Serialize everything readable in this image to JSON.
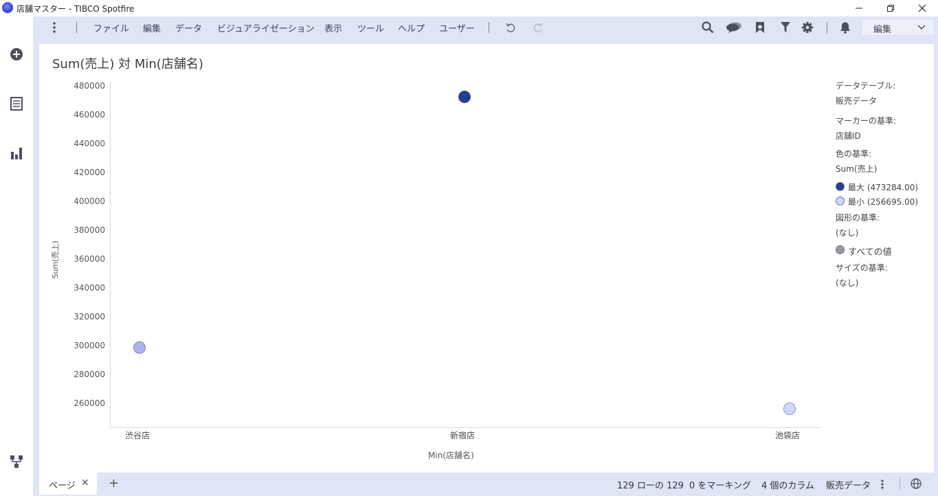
{
  "window": {
    "title": "店舗マスター - TIBCO Spotfire",
    "minimize_glyph": "—",
    "close_glyph": "✕"
  },
  "menu": {
    "items": [
      "ファイル",
      "編集",
      "データ",
      "ビジュアライゼーション",
      "表示",
      "ツール",
      "ヘルプ",
      "ユーザー"
    ],
    "mode_select": "編集"
  },
  "left_rail": {
    "icons": [
      "add-icon",
      "data-table-icon",
      "visualization-icon",
      "data-canvas-icon"
    ]
  },
  "toolbar_icons": [
    "undo-icon",
    "redo-icon",
    "search-icon",
    "collaboration-icon",
    "bookmark-icon",
    "filter-icon",
    "settings-icon",
    "notifications-icon"
  ],
  "visualization": {
    "title": "Sum(売上) 対 Min(店舗名)"
  },
  "chart_data": {
    "type": "scatter",
    "title": "Sum(売上) 対 Min(店舗名)",
    "xlabel": "Min(店舗名)",
    "ylabel": "Sum(売上)",
    "categories": [
      "渋谷店",
      "新宿店",
      "池袋店"
    ],
    "y_ticks": [
      "480000",
      "460000",
      "440000",
      "420000",
      "400000",
      "380000",
      "360000",
      "340000",
      "320000",
      "300000",
      "280000",
      "260000"
    ],
    "ylim": [
      244000,
      484000
    ],
    "points": [
      {
        "x": "渋谷店",
        "y": 299300,
        "color": "#aab4e8"
      },
      {
        "x": "新宿店",
        "y": 473284,
        "color": "#23408f"
      },
      {
        "x": "池袋店",
        "y": 256695,
        "color": "#cfd8f8"
      }
    ],
    "color_scale": {
      "max": 473284.0,
      "min": 256695.0,
      "max_color": "#23408f",
      "min_color": "#cfd8f8"
    }
  },
  "legend": {
    "data_table_label": "データテーブル:",
    "data_table_value": "販売データ",
    "marker_by_label": "マーカーの基準:",
    "marker_by_value": "店舗ID",
    "color_by_label": "色の基準:",
    "color_by_value": "Sum(売上)",
    "max_entry": "最大 (473284.00)",
    "min_entry": "最小 (256695.00)",
    "shape_by_label": "図形の基準:",
    "shape_by_value": "(なし)",
    "all_values": "すべての値",
    "size_by_label": "サイズの基準:",
    "size_by_value": "(なし)",
    "max_color": "#23408f",
    "min_color": "#cfd8f8",
    "all_values_color": "#9a9a9a"
  },
  "status": {
    "page_tab": "ページ",
    "close_tab": "✕",
    "add_page": "+",
    "rows": "129 ローの 129",
    "marking": "0 をマーキング",
    "columns": "4 個のカラム",
    "table": "販売データ"
  }
}
